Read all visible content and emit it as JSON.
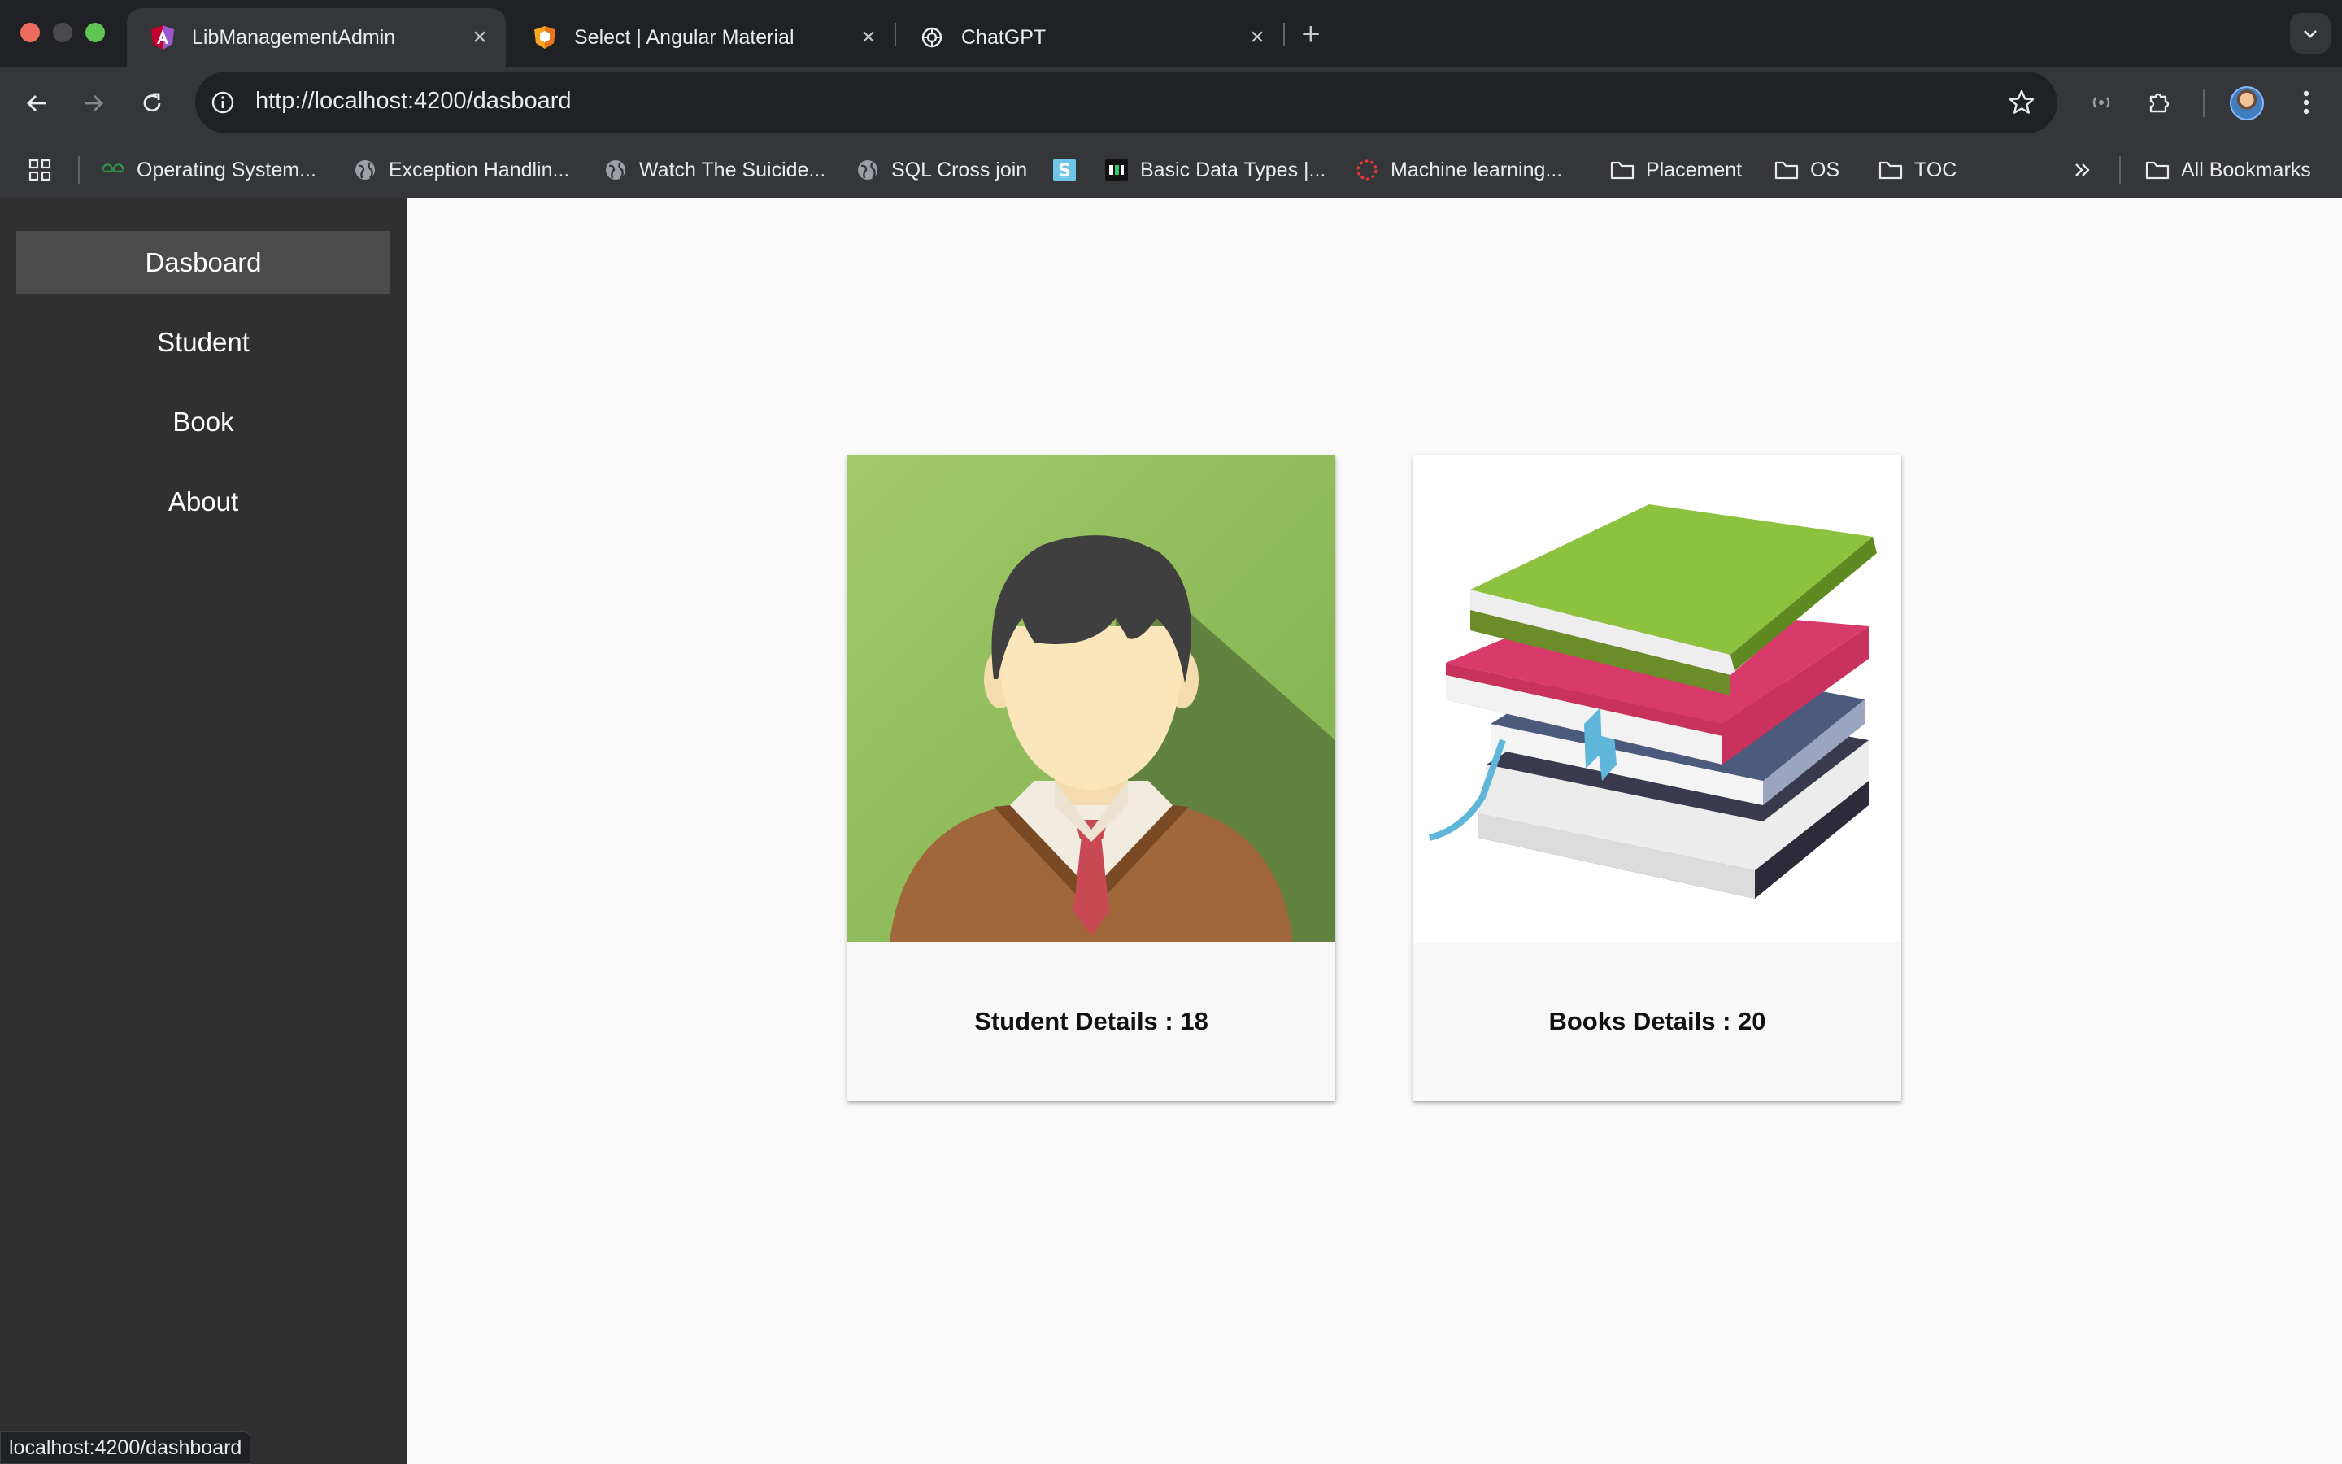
{
  "browser": {
    "tabs": [
      {
        "title": "LibManagementAdmin",
        "icon": "angular-icon",
        "active": true
      },
      {
        "title": "Select | Angular Material",
        "icon": "angular-material-icon",
        "active": false
      },
      {
        "title": "ChatGPT",
        "icon": "chatgpt-icon",
        "active": false
      }
    ],
    "url": "http://localhost:4200/dasboard",
    "bookmarks": [
      {
        "label": "Operating System...",
        "icon": "gfg-icon"
      },
      {
        "label": "Exception Handlin...",
        "icon": "globe-icon"
      },
      {
        "label": "Watch The Suicide...",
        "icon": "globe-icon"
      },
      {
        "label": "SQL Cross join",
        "icon": "globe-icon"
      },
      {
        "label": "",
        "icon": "s-icon"
      },
      {
        "label": "Basic Data Types |...",
        "icon": "data-icon"
      },
      {
        "label": "Machine learning...",
        "icon": "ring-icon"
      },
      {
        "label": "Placement",
        "icon": "folder-icon"
      },
      {
        "label": "OS",
        "icon": "folder-icon"
      },
      {
        "label": "TOC",
        "icon": "folder-icon"
      }
    ],
    "all_bookmarks": "All Bookmarks",
    "status_url": "localhost:4200/dashboard"
  },
  "sidebar": {
    "items": [
      {
        "label": "Dasboard",
        "active": true
      },
      {
        "label": "Student",
        "active": false
      },
      {
        "label": "Book",
        "active": false
      },
      {
        "label": "About",
        "active": false
      }
    ]
  },
  "cards": [
    {
      "caption": "Student Details : 18",
      "image": "student-avatar-illustration"
    },
    {
      "caption": "Books Details : 20",
      "image": "book-stack-illustration"
    }
  ],
  "colors": {
    "sidebar_bg": "#303030",
    "sidebar_active": "#4b4b4b",
    "content_bg": "#fafafa",
    "chrome_dark": "#202124",
    "chrome_mid": "#35363a"
  }
}
